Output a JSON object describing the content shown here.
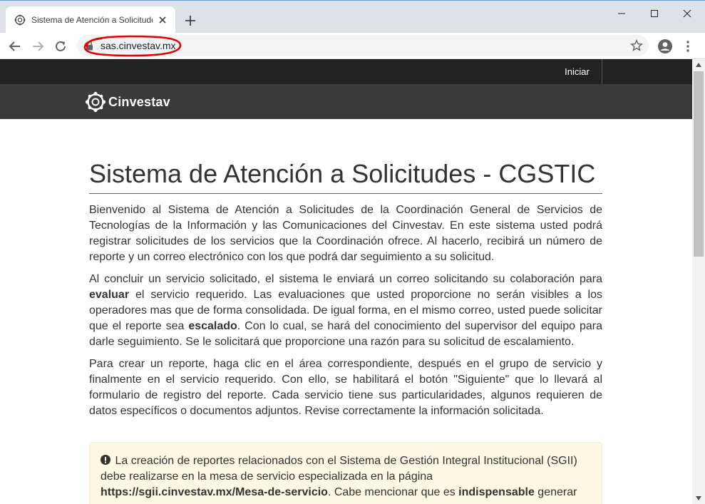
{
  "browser": {
    "tab_title": "Sistema de Atención a Solicitudes",
    "url": "sas.cinvestav.mx"
  },
  "site": {
    "nav_link": "Iniciar",
    "brand_name": "Cinvestav"
  },
  "page": {
    "title": "Sistema de Atención a Solicitudes - CGSTIC",
    "paragraph1": "Bienvenido al Sistema de Atención a Solicitudes de la Coordinación General de Servicios de Tecnologías de la Información y las Comunicaciones del Cinvestav. En este sistema usted podrá registrar solicitudes de los servicios que la Coordinación ofrece. Al hacerlo, recibirá un número de reporte y un correo electrónico con los que podrá dar seguimiento a su solicitud.",
    "paragraph2": {
      "part1": "Al concluir un servicio solicitado, el sistema le enviará un correo solicitando su colaboración para ",
      "bold1": "evaluar",
      "part2": " el servicio requerido. Las evaluaciones que usted proporcione no serán visibles a los operadores mas que de forma consolidada. De igual forma, en el mismo correo, usted puede solicitar que el reporte sea ",
      "bold2": "escalado",
      "part3": ". Con lo cual, se hará del conocimiento del supervisor del equipo para darle seguimiento. Se le solicitará que proporcione una razón para su solicitud de escalamiento."
    },
    "paragraph3": "Para crear un reporte, haga clic en el área correspondiente, después en el grupo de servicio y finalmente en el servicio requerido. Con ello, se habilitará el botón \"Siguiente\" que lo llevará al formulario de registro del reporte. Cada servicio tiene sus particularidades, algunos requieren de datos específicos o documentos adjuntos. Revise correctamente la información solicitada.",
    "alert": {
      "part1": " La creación de reportes relacionados con el Sistema de Gestión Integral Institucional (SGII) debe realizarse en la mesa de servicio especializada en la página ",
      "link": "https://sgii.cinvestav.mx/Mesa-de-servicio",
      "part2": ". Cabe mencionar que es ",
      "bold": "indispensable",
      "part3": " generar"
    }
  },
  "icons": {
    "favicon": "cinvestav-logo-icon",
    "close": "close-icon",
    "new_tab": "plus-icon",
    "back": "back-arrow-icon",
    "forward": "forward-arrow-icon",
    "reload": "reload-icon",
    "lock": "lock-icon",
    "bookmark": "star-icon",
    "profile": "account-icon",
    "menu": "more-vert-icon",
    "alert": "exclamation-circle-icon"
  },
  "colors": {
    "nav_bar": "#222222",
    "brand_bar": "#3a3a3a",
    "alert_bg": "#fcf8e3",
    "annotation": "#e00000"
  }
}
